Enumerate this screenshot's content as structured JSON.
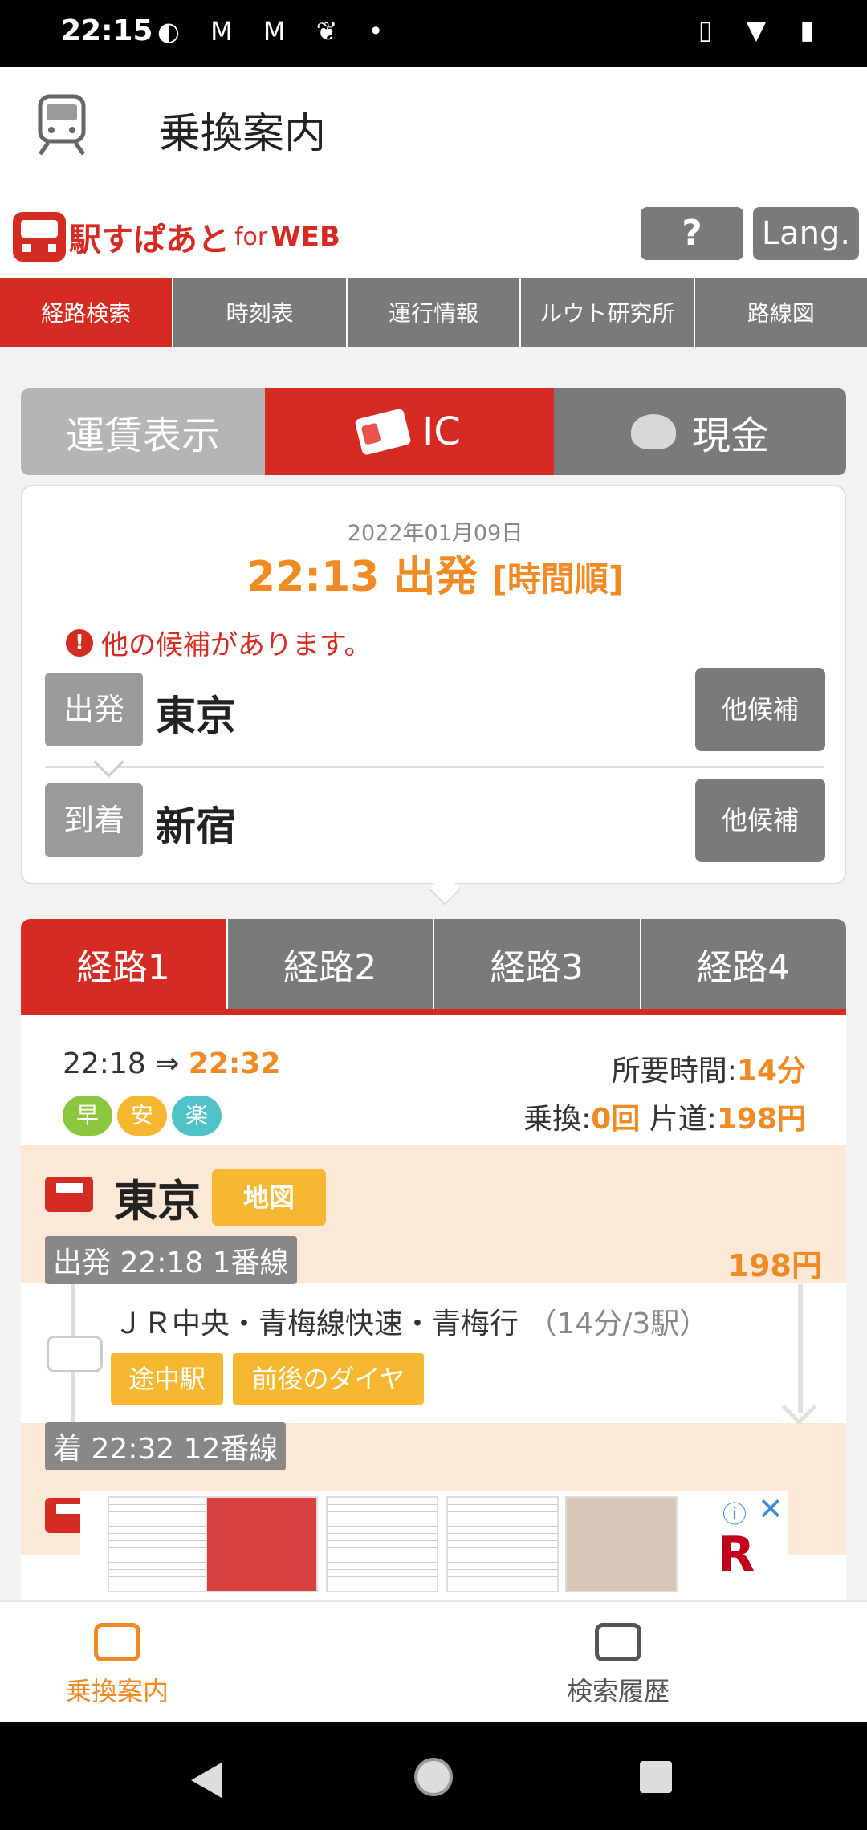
{
  "status_bar": {
    "time": "22:15",
    "left_icons": "◐ M M ❦ •",
    "right_icons": "▯ ▼ ▮"
  },
  "app_bar": {
    "title": "乗換案内"
  },
  "web_header": {
    "logo_text": "駅すぱあと",
    "logo_for": "for",
    "logo_web": "WEB",
    "help_label": "?",
    "lang_label": "Lang."
  },
  "nav_tabs": [
    {
      "label": "経路検索",
      "active": true
    },
    {
      "label": "時刻表",
      "active": false
    },
    {
      "label": "運行情報",
      "active": false
    },
    {
      "label": "ルウト研究所",
      "active": false
    },
    {
      "label": "路線図",
      "active": false
    }
  ],
  "fare_tabs": {
    "fare_display": "運賃表示",
    "ic": "IC",
    "cash": "現金"
  },
  "search": {
    "date": "2022年01月09日",
    "depart_time": "22:13 出発",
    "order": "[時間順]",
    "alert": "他の候補があります。",
    "alert_icon": "!",
    "from_label": "出発",
    "from_station": "東京",
    "to_label": "到着",
    "to_station": "新宿",
    "other_candidates": "他候補"
  },
  "route_tabs": [
    "経路1",
    "経路2",
    "経路3",
    "経路4"
  ],
  "summary": {
    "depart": "22:18 ⇒ ",
    "arrive": "22:32",
    "required_label": "所要時間:",
    "required_value": "14分",
    "transfer_label": "乗換:",
    "transfer_value": "0回",
    "oneway_label": " 片道:",
    "oneway_value": "198円",
    "badges": [
      {
        "label": "早",
        "color": "#8cc63e"
      },
      {
        "label": "安",
        "color": "#f5b830"
      },
      {
        "label": "楽",
        "color": "#4fc3c8"
      }
    ]
  },
  "detail": {
    "station": "東京",
    "map_label": "地図",
    "depart_info": "出発 22:18 1番線",
    "fare": "198円",
    "line": "ＪＲ中央・青梅線快速・青梅行",
    "line_duration": "（14分/3駅）",
    "via_stations": "途中駅",
    "timetable": "前後のダイヤ",
    "arrive_info": "着 22:32 12番線"
  },
  "ad": {
    "info_icon": "ⓘ",
    "close_icon": "✕",
    "logo": "R"
  },
  "bottom_nav": [
    {
      "label": "乗換案内",
      "active": true
    },
    {
      "label": "検索履歴",
      "active": false
    }
  ],
  "colors": {
    "brand_red": "#d62b22",
    "accent_orange": "#ef8a24",
    "tab_gray": "#7a7a7a"
  }
}
